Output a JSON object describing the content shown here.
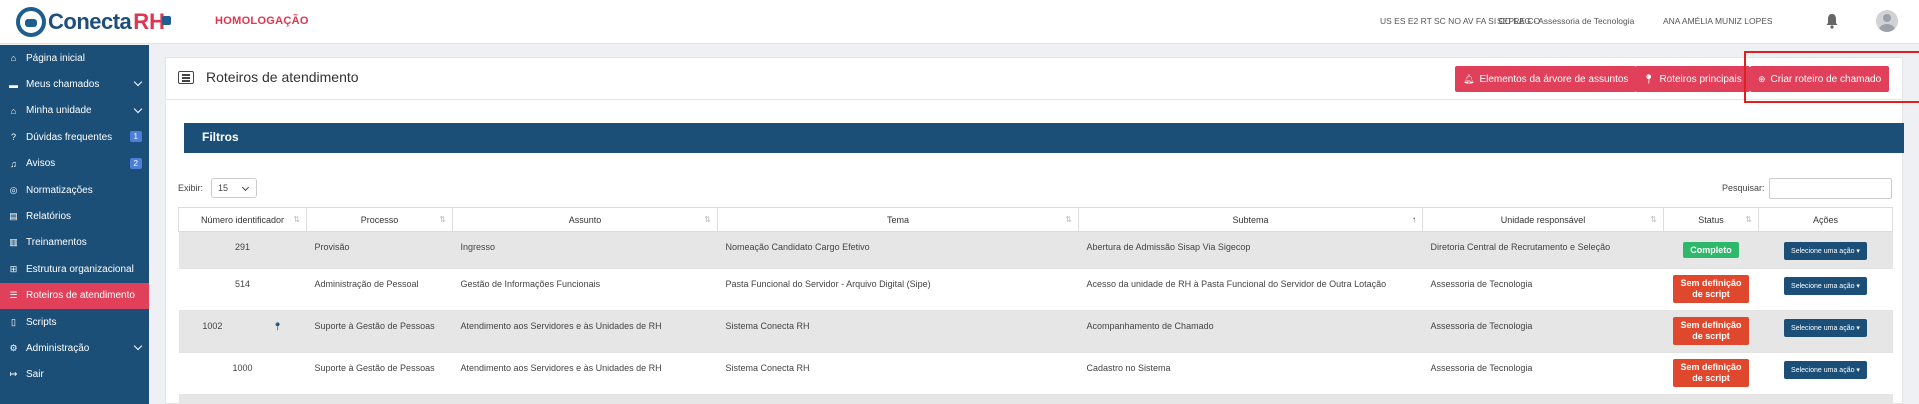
{
  "header": {
    "logo_text": "Conecta",
    "logo_rh": "RH",
    "environment": "HOMOLOGAÇÃO",
    "states": "US ES E2 RT SC NO AV FA SI CC RE CO",
    "org": "SEPLAG - Assessoria de Tecnologia",
    "user": "ANA AMÉLIA MUNIZ LOPES"
  },
  "sidebar": {
    "items": [
      {
        "label": "Página inicial",
        "icon": "home-icon"
      },
      {
        "label": "Meus chamados",
        "icon": "card-icon",
        "chevron": true
      },
      {
        "label": "Minha unidade",
        "icon": "home-icon",
        "chevron": true
      },
      {
        "label": "Dúvidas frequentes",
        "icon": "question-icon",
        "badge": "1"
      },
      {
        "label": "Avisos",
        "icon": "bell-icon",
        "badge": "2"
      },
      {
        "label": "Normatizações",
        "icon": "compass-icon"
      },
      {
        "label": "Relatórios",
        "icon": "chart-icon"
      },
      {
        "label": "Treinamentos",
        "icon": "book-icon"
      },
      {
        "label": "Estrutura organizacional",
        "icon": "sitemap-icon"
      },
      {
        "label": "Roteiros de atendimento",
        "icon": "list-icon",
        "active": true
      },
      {
        "label": "Scripts",
        "icon": "file-icon"
      },
      {
        "label": "Administração",
        "icon": "cogs-icon",
        "chevron": true
      },
      {
        "label": "Sair",
        "icon": "signout-icon"
      }
    ]
  },
  "page": {
    "title": "Roteiros de atendimento",
    "buttons": {
      "tree": "Elementos da árvore de assuntos",
      "main": "Roteiros principais",
      "create": "Criar roteiro de chamado"
    },
    "filters_label": "Filtros",
    "show_label": "Exibir:",
    "show_value": "15",
    "search_label": "Pesquisar:"
  },
  "table": {
    "headers": [
      "Número identificador",
      "Processo",
      "Assunto",
      "Tema",
      "Subtema",
      "Unidade responsável",
      "Status",
      "Ações"
    ],
    "action_label": "Selecione uma ação",
    "rows": [
      {
        "id": "291",
        "processo": "Provisão",
        "assunto": "Ingresso",
        "tema": "Nomeação Candidato Cargo Efetivo",
        "subtema": "Abertura de Admissão Sisap Via Sigecop",
        "unidade": "Diretoria Central de Recrutamento e Seleção",
        "status": "Completo",
        "status_type": "green"
      },
      {
        "id": "514",
        "processo": "Administração de Pessoal",
        "assunto": "Gestão de Informações Funcionais",
        "tema": "Pasta Funcional do Servidor - Arquivo Digital (Sipe)",
        "subtema": "Acesso da unidade de RH à Pasta Funcional do Servidor de Outra Lotação",
        "unidade": "Assessoria de Tecnologia",
        "status": "Sem definição de script",
        "status_type": "red"
      },
      {
        "id": "1002",
        "processo": "Suporte à Gestão de Pessoas",
        "assunto": "Atendimento aos Servidores e às Unidades de RH",
        "tema": "Sistema Conecta RH",
        "subtema": "Acompanhamento de Chamado",
        "unidade": "Assessoria de Tecnologia",
        "status": "Sem definição de script",
        "status_type": "red"
      },
      {
        "id": "1000",
        "processo": "Suporte à Gestão de Pessoas",
        "assunto": "Atendimento aos Servidores e às Unidades de RH",
        "tema": "Sistema Conecta RH",
        "subtema": "Cadastro no Sistema",
        "unidade": "Assessoria de Tecnologia",
        "status": "Sem definição de script",
        "status_type": "red"
      }
    ]
  }
}
